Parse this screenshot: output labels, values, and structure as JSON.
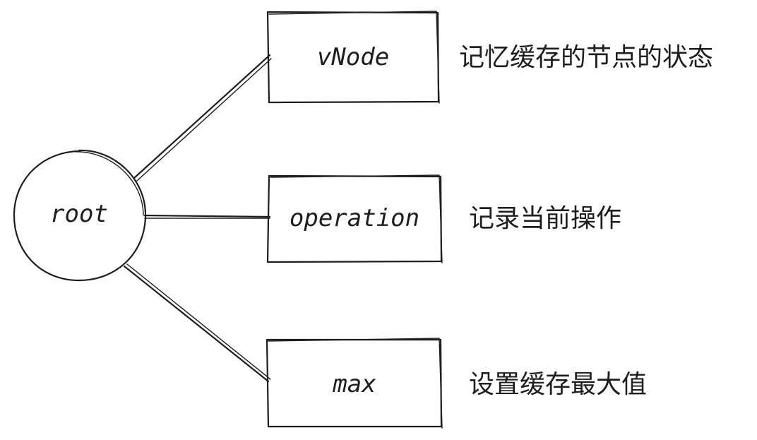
{
  "diagram": {
    "root": {
      "label": "root"
    },
    "nodes": [
      {
        "id": "vnode",
        "label": "vNode",
        "note": "记忆缓存的节点的状态"
      },
      {
        "id": "operation",
        "label": "operation",
        "note": "记录当前操作"
      },
      {
        "id": "max",
        "label": "max",
        "note": "设置缓存最大值"
      }
    ],
    "stroke_color": "#1e1e1e",
    "background": "#ffffff"
  }
}
